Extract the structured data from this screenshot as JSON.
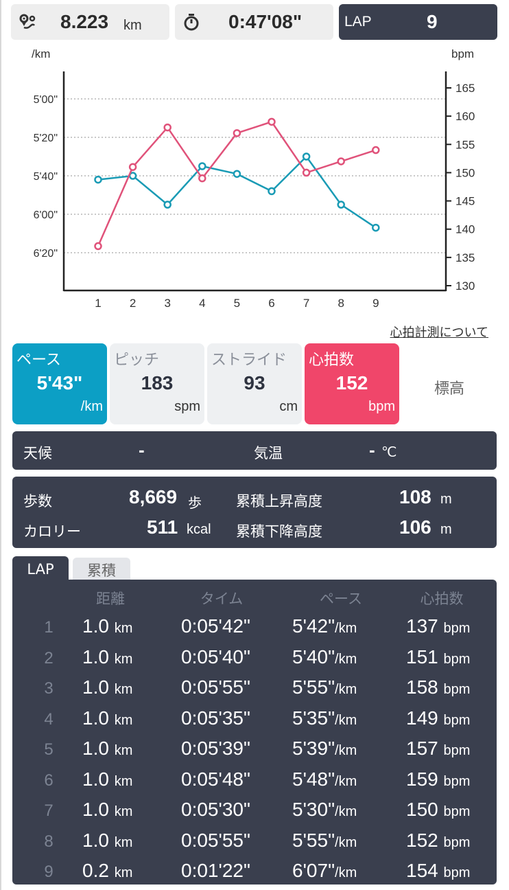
{
  "summary": {
    "distance_value": "8.223",
    "distance_unit": "km",
    "time": "0:47'08\"",
    "lap_label": "LAP",
    "lap_value": "9"
  },
  "chart_data": {
    "type": "line",
    "x": [
      1,
      2,
      3,
      4,
      5,
      6,
      7,
      8,
      9
    ],
    "left_axis_unit": "/km",
    "right_axis_unit": "bpm",
    "left_ticks": [
      "5'00\"",
      "5'20\"",
      "5'40\"",
      "6'00\"",
      "6'20\""
    ],
    "right_ticks": [
      130,
      135,
      140,
      145,
      150,
      155,
      160,
      165
    ],
    "left_range_seconds": [
      280,
      400
    ],
    "right_range": [
      130,
      165
    ],
    "series": [
      {
        "axis": "left",
        "color": "#1a9bb5",
        "unit": "pace",
        "values_seconds": [
          342,
          340,
          355,
          335,
          339,
          348,
          330,
          355,
          367
        ]
      },
      {
        "axis": "right",
        "color": "#e0527a",
        "unit": "bpm",
        "values": [
          137,
          151,
          158,
          149,
          157,
          159,
          150,
          152,
          154
        ]
      }
    ],
    "grid": "horizontal-dotted"
  },
  "hr_link": "心拍計測について",
  "tiles": {
    "pace": {
      "label": "ペース",
      "value": "5'43\"",
      "unit": "/km"
    },
    "pitch": {
      "label": "ピッチ",
      "value": "183",
      "unit": "spm"
    },
    "stride": {
      "label": "ストライド",
      "value": "93",
      "unit": "cm"
    },
    "hr": {
      "label": "心拍数",
      "value": "152",
      "unit": "bpm"
    },
    "elevation": {
      "label": "標高"
    }
  },
  "weather": {
    "weather_label": "天候",
    "weather_value": "-",
    "temp_label": "気温",
    "temp_value": "-",
    "temp_unit": "℃"
  },
  "stats": {
    "steps_label": "歩数",
    "steps_value": "8,669",
    "steps_unit": "歩",
    "calorie_label": "カロリー",
    "calorie_value": "511",
    "calorie_unit": "kcal",
    "ascent_label": "累積上昇高度",
    "ascent_value": "108",
    "ascent_unit": "m",
    "descent_label": "累積下降高度",
    "descent_value": "106",
    "descent_unit": "m"
  },
  "lap_tabs": {
    "lap": "LAP",
    "cumulative": "累積"
  },
  "lap_table": {
    "headers": {
      "distance": "距離",
      "time": "タイム",
      "pace": "ペース",
      "hr": "心拍数"
    },
    "rows": [
      {
        "idx": "1",
        "dist": "1.0",
        "dist_unit": "km",
        "time": "0:05'42\"",
        "pace": "5'42\"",
        "pace_unit": "/km",
        "hr": "137",
        "hr_unit": "bpm"
      },
      {
        "idx": "2",
        "dist": "1.0",
        "dist_unit": "km",
        "time": "0:05'40\"",
        "pace": "5'40\"",
        "pace_unit": "/km",
        "hr": "151",
        "hr_unit": "bpm"
      },
      {
        "idx": "3",
        "dist": "1.0",
        "dist_unit": "km",
        "time": "0:05'55\"",
        "pace": "5'55\"",
        "pace_unit": "/km",
        "hr": "158",
        "hr_unit": "bpm"
      },
      {
        "idx": "4",
        "dist": "1.0",
        "dist_unit": "km",
        "time": "0:05'35\"",
        "pace": "5'35\"",
        "pace_unit": "/km",
        "hr": "149",
        "hr_unit": "bpm"
      },
      {
        "idx": "5",
        "dist": "1.0",
        "dist_unit": "km",
        "time": "0:05'39\"",
        "pace": "5'39\"",
        "pace_unit": "/km",
        "hr": "157",
        "hr_unit": "bpm"
      },
      {
        "idx": "6",
        "dist": "1.0",
        "dist_unit": "km",
        "time": "0:05'48\"",
        "pace": "5'48\"",
        "pace_unit": "/km",
        "hr": "159",
        "hr_unit": "bpm"
      },
      {
        "idx": "7",
        "dist": "1.0",
        "dist_unit": "km",
        "time": "0:05'30\"",
        "pace": "5'30\"",
        "pace_unit": "/km",
        "hr": "150",
        "hr_unit": "bpm"
      },
      {
        "idx": "8",
        "dist": "1.0",
        "dist_unit": "km",
        "time": "0:05'55\"",
        "pace": "5'55\"",
        "pace_unit": "/km",
        "hr": "152",
        "hr_unit": "bpm"
      },
      {
        "idx": "9",
        "dist": "0.2",
        "dist_unit": "km",
        "time": "0:01'22\"",
        "pace": "6'07\"",
        "pace_unit": "/km",
        "hr": "154",
        "hr_unit": "bpm"
      }
    ]
  }
}
